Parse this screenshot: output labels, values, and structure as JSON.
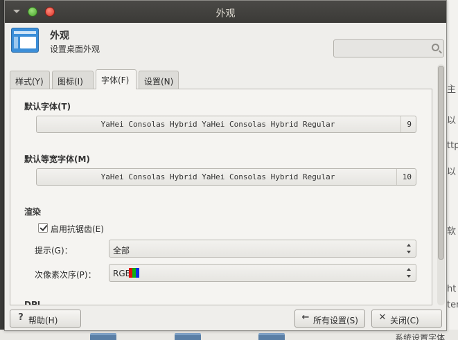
{
  "window": {
    "title": "外观"
  },
  "header": {
    "title": "外观",
    "subtitle": "设置桌面外观",
    "search_placeholder": ""
  },
  "tabs": [
    {
      "label": "样式(Y)"
    },
    {
      "label": "图标(I)"
    },
    {
      "label": "字体(F)"
    },
    {
      "label": "设置(N)"
    }
  ],
  "fonts": {
    "default_label": "默认字体(T)",
    "default_font": "YaHei Consolas Hybrid YaHei Consolas Hybrid Regular",
    "default_size": "9",
    "mono_label": "默认等宽字体(M)",
    "mono_font": "YaHei Consolas Hybrid YaHei Consolas Hybrid Regular",
    "mono_size": "10"
  },
  "render": {
    "label": "渲染",
    "antialias_label": "启用抗锯齿(E)",
    "antialias_checked": true,
    "hint_label": "提示(G)：",
    "hint_value": "全部",
    "subpixel_label": "次像素次序(P)：",
    "subpixel_value": "RGB",
    "dpi_label": "DPI"
  },
  "footer": {
    "help": "帮助(H)",
    "all_settings": "所有设置(S)",
    "close": "关闭(C)"
  },
  "background": {
    "right_chars": [
      "主",
      "以",
      "ttp",
      "以",
      "软",
      "ht",
      "ter"
    ],
    "bottom_text": "系统设置字体"
  },
  "colors": {
    "accent_blue": "#3b8ed8",
    "close_red": "#d9352a",
    "max_green": "#4aa52d"
  }
}
